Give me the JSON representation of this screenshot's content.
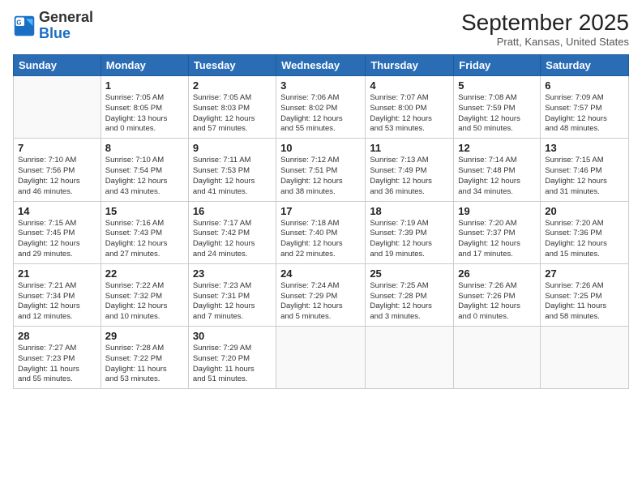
{
  "logo": {
    "general": "General",
    "blue": "Blue"
  },
  "header": {
    "month": "September 2025",
    "location": "Pratt, Kansas, United States"
  },
  "days_of_week": [
    "Sunday",
    "Monday",
    "Tuesday",
    "Wednesday",
    "Thursday",
    "Friday",
    "Saturday"
  ],
  "weeks": [
    [
      {
        "num": "",
        "info": ""
      },
      {
        "num": "1",
        "info": "Sunrise: 7:05 AM\nSunset: 8:05 PM\nDaylight: 13 hours\nand 0 minutes."
      },
      {
        "num": "2",
        "info": "Sunrise: 7:05 AM\nSunset: 8:03 PM\nDaylight: 12 hours\nand 57 minutes."
      },
      {
        "num": "3",
        "info": "Sunrise: 7:06 AM\nSunset: 8:02 PM\nDaylight: 12 hours\nand 55 minutes."
      },
      {
        "num": "4",
        "info": "Sunrise: 7:07 AM\nSunset: 8:00 PM\nDaylight: 12 hours\nand 53 minutes."
      },
      {
        "num": "5",
        "info": "Sunrise: 7:08 AM\nSunset: 7:59 PM\nDaylight: 12 hours\nand 50 minutes."
      },
      {
        "num": "6",
        "info": "Sunrise: 7:09 AM\nSunset: 7:57 PM\nDaylight: 12 hours\nand 48 minutes."
      }
    ],
    [
      {
        "num": "7",
        "info": "Sunrise: 7:10 AM\nSunset: 7:56 PM\nDaylight: 12 hours\nand 46 minutes."
      },
      {
        "num": "8",
        "info": "Sunrise: 7:10 AM\nSunset: 7:54 PM\nDaylight: 12 hours\nand 43 minutes."
      },
      {
        "num": "9",
        "info": "Sunrise: 7:11 AM\nSunset: 7:53 PM\nDaylight: 12 hours\nand 41 minutes."
      },
      {
        "num": "10",
        "info": "Sunrise: 7:12 AM\nSunset: 7:51 PM\nDaylight: 12 hours\nand 38 minutes."
      },
      {
        "num": "11",
        "info": "Sunrise: 7:13 AM\nSunset: 7:49 PM\nDaylight: 12 hours\nand 36 minutes."
      },
      {
        "num": "12",
        "info": "Sunrise: 7:14 AM\nSunset: 7:48 PM\nDaylight: 12 hours\nand 34 minutes."
      },
      {
        "num": "13",
        "info": "Sunrise: 7:15 AM\nSunset: 7:46 PM\nDaylight: 12 hours\nand 31 minutes."
      }
    ],
    [
      {
        "num": "14",
        "info": "Sunrise: 7:15 AM\nSunset: 7:45 PM\nDaylight: 12 hours\nand 29 minutes."
      },
      {
        "num": "15",
        "info": "Sunrise: 7:16 AM\nSunset: 7:43 PM\nDaylight: 12 hours\nand 27 minutes."
      },
      {
        "num": "16",
        "info": "Sunrise: 7:17 AM\nSunset: 7:42 PM\nDaylight: 12 hours\nand 24 minutes."
      },
      {
        "num": "17",
        "info": "Sunrise: 7:18 AM\nSunset: 7:40 PM\nDaylight: 12 hours\nand 22 minutes."
      },
      {
        "num": "18",
        "info": "Sunrise: 7:19 AM\nSunset: 7:39 PM\nDaylight: 12 hours\nand 19 minutes."
      },
      {
        "num": "19",
        "info": "Sunrise: 7:20 AM\nSunset: 7:37 PM\nDaylight: 12 hours\nand 17 minutes."
      },
      {
        "num": "20",
        "info": "Sunrise: 7:20 AM\nSunset: 7:36 PM\nDaylight: 12 hours\nand 15 minutes."
      }
    ],
    [
      {
        "num": "21",
        "info": "Sunrise: 7:21 AM\nSunset: 7:34 PM\nDaylight: 12 hours\nand 12 minutes."
      },
      {
        "num": "22",
        "info": "Sunrise: 7:22 AM\nSunset: 7:32 PM\nDaylight: 12 hours\nand 10 minutes."
      },
      {
        "num": "23",
        "info": "Sunrise: 7:23 AM\nSunset: 7:31 PM\nDaylight: 12 hours\nand 7 minutes."
      },
      {
        "num": "24",
        "info": "Sunrise: 7:24 AM\nSunset: 7:29 PM\nDaylight: 12 hours\nand 5 minutes."
      },
      {
        "num": "25",
        "info": "Sunrise: 7:25 AM\nSunset: 7:28 PM\nDaylight: 12 hours\nand 3 minutes."
      },
      {
        "num": "26",
        "info": "Sunrise: 7:26 AM\nSunset: 7:26 PM\nDaylight: 12 hours\nand 0 minutes."
      },
      {
        "num": "27",
        "info": "Sunrise: 7:26 AM\nSunset: 7:25 PM\nDaylight: 11 hours\nand 58 minutes."
      }
    ],
    [
      {
        "num": "28",
        "info": "Sunrise: 7:27 AM\nSunset: 7:23 PM\nDaylight: 11 hours\nand 55 minutes."
      },
      {
        "num": "29",
        "info": "Sunrise: 7:28 AM\nSunset: 7:22 PM\nDaylight: 11 hours\nand 53 minutes."
      },
      {
        "num": "30",
        "info": "Sunrise: 7:29 AM\nSunset: 7:20 PM\nDaylight: 11 hours\nand 51 minutes."
      },
      {
        "num": "",
        "info": ""
      },
      {
        "num": "",
        "info": ""
      },
      {
        "num": "",
        "info": ""
      },
      {
        "num": "",
        "info": ""
      }
    ]
  ]
}
